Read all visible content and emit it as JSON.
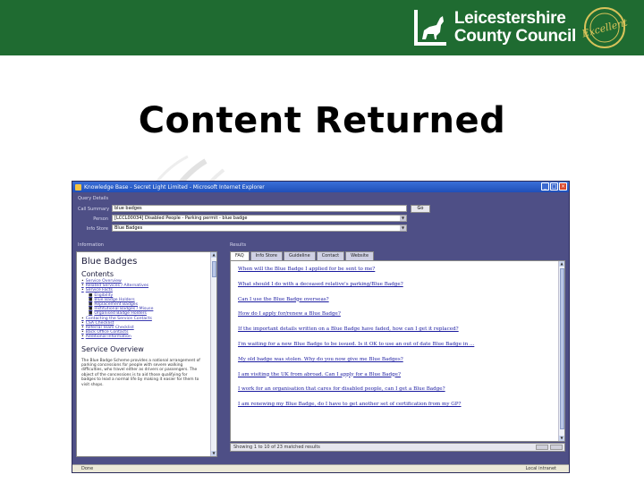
{
  "slide": {
    "title": "Content Returned",
    "logo_line1": "Leicestershire",
    "logo_line2": "County Council",
    "logo_seal": "RATED AS Excellent BY AUDIT COMMISSION"
  },
  "window": {
    "title": "Knowledge Base - Secret Light Limited - Microsoft Internet Explorer",
    "query_details_label": "Query Details",
    "call_summary_label": "Call Summary",
    "call_summary_value": "blue badges",
    "go_label": "Go",
    "person_label": "Person",
    "person_value": "[LCCL00034] Disabled People - Parking permit - blue badge",
    "info_store_label": "Info Store",
    "info_store_value": "Blue Badges",
    "information_label": "Information",
    "results_label": "Results",
    "status_left": "Done",
    "status_right": "Local intranet"
  },
  "left_panel": {
    "title": "Blue Badges",
    "contents_heading": "Contents",
    "items": [
      {
        "label": "Service Overview",
        "sub": false
      },
      {
        "label": "Related Services / Alternatives",
        "sub": false
      },
      {
        "label": "Service Facts",
        "sub": false
      },
      {
        "label": "Eligibility",
        "sub": true
      },
      {
        "label": "Blue Badge Holders",
        "sub": true
      },
      {
        "label": "Replacement Badges",
        "sub": true
      },
      {
        "label": "Institutional Badges / Misuse",
        "sub": true
      },
      {
        "label": "Organised Badge Holders",
        "sub": true
      },
      {
        "label": "Contacting the Service Contacts",
        "sub": false
      },
      {
        "label": "CSA Checklist",
        "sub": false
      },
      {
        "label": "Referral Team Checklist",
        "sub": false
      },
      {
        "label": "Back Office Contacts",
        "sub": false
      },
      {
        "label": "Additional Information",
        "sub": false
      }
    ],
    "service_heading": "Service Overview",
    "body": "The Blue Badge Scheme provides a national arrangement of parking concessions for people with severe walking difficulties, who travel either as drivers or passengers. The object of the concessions is to aid those qualifying for badges to lead a normal life by making it easier for them to visit shops."
  },
  "tabs": [
    "FAQ",
    "Info Store",
    "Guideline",
    "Contact",
    "Website"
  ],
  "faq": [
    "When will the Blue Badge I applied for be sent to me?",
    "What should I do with a deceased relative's parking/Blue Badge?",
    "Can I use the Blue Badge overseas?",
    "How do I apply for/renew a Blue Badge?",
    "If the important details written on a Blue Badge have faded, how can I get it replaced?",
    "I'm waiting for a new Blue Badge to be issued. Is it OK to use an out of date Blue Badge in ...",
    "My old badge was stolen. Why do you now give me Blue Badges?",
    "I am visiting the UK from abroad. Can I apply for a Blue Badge?",
    "I work for an organisation that cares for disabled people, can I get a Blue Badge?",
    "I am renewing my Blue Badge, do I have to get another set of certification from my GP?"
  ],
  "results_status": "Showing 1 to 10 of 23 matched results",
  "colors": {
    "header_green": "#1f6b31",
    "window_bg": "#4e4f86",
    "link_blue": "#1a1aa0"
  }
}
